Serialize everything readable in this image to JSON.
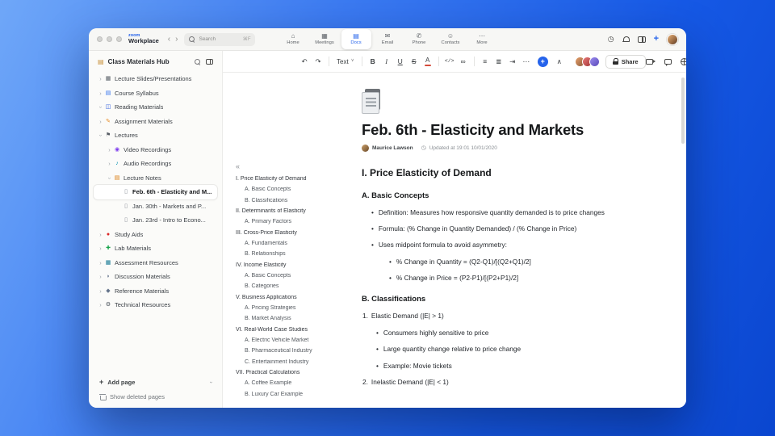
{
  "icons": {
    "back": "‹",
    "forward": "›",
    "tree_chevron": "›",
    "footer_chevron": "›",
    "plus": "+",
    "clock": "◷",
    "hub": "▤",
    "outline_collapse": "«",
    "more": "⋯"
  },
  "titlebar": {
    "brand_top": "zoom",
    "brand_bottom": "Workplace",
    "search": {
      "placeholder": "Search",
      "shortcut": "⌘F"
    },
    "tabs": [
      {
        "label": "Home",
        "icon": "home",
        "glyph": "⌂",
        "active": false
      },
      {
        "label": "Meetings",
        "icon": "meetings-calendar",
        "glyph": "▦",
        "active": false
      },
      {
        "label": "Docs",
        "icon": "docs-document",
        "glyph": "▤",
        "active": true
      },
      {
        "label": "Email",
        "icon": "email-envelope",
        "glyph": "✉",
        "active": false
      },
      {
        "label": "Phone",
        "icon": "phone",
        "glyph": "✆",
        "active": false
      },
      {
        "label": "Contacts",
        "icon": "contacts-person",
        "glyph": "☺",
        "active": false
      },
      {
        "label": "More",
        "icon": "more-dots",
        "glyph": "⋯",
        "active": false
      }
    ]
  },
  "sidebar": {
    "title": "Class Materials Hub",
    "items": [
      {
        "label": "Lecture Slides/Presentations",
        "depth": 0,
        "chevron": "right",
        "icon": "presentation",
        "glyph": "▦",
        "color": "#555b63"
      },
      {
        "label": "Course Syllabus",
        "depth": 0,
        "chevron": "right",
        "icon": "syllabus-document",
        "glyph": "▤",
        "color": "#2f6fed"
      },
      {
        "label": "Reading Materials",
        "depth": 0,
        "chevron": "down",
        "icon": "open-book",
        "glyph": "◫",
        "color": "#1d4ed8"
      },
      {
        "label": "Assignment Materials",
        "depth": 0,
        "chevron": "right",
        "icon": "assignment-pencil",
        "glyph": "✎",
        "color": "#e8912d"
      },
      {
        "label": "Lectures",
        "depth": 0,
        "chevron": "down",
        "icon": "lectures-flag",
        "glyph": "⚑",
        "color": "#555b63"
      },
      {
        "label": "Video Recordings",
        "depth": 1,
        "chevron": "right",
        "icon": "video-recording",
        "glyph": "◉",
        "color": "#7c3aed"
      },
      {
        "label": "Audio Recordings",
        "depth": 1,
        "chevron": "right",
        "icon": "audio-note",
        "glyph": "♪",
        "color": "#0891b2"
      },
      {
        "label": "Lecture Notes",
        "depth": 1,
        "chevron": "down",
        "icon": "notes-document",
        "glyph": "▤",
        "color": "#d97706"
      },
      {
        "label": "Feb. 6th - Elasticity and M...",
        "depth": 2,
        "chevron": null,
        "icon": "page",
        "glyph": "▯",
        "color": "#8a8f98",
        "selected": true
      },
      {
        "label": "Jan. 30th - Markets and P...",
        "depth": 2,
        "chevron": null,
        "icon": "page",
        "glyph": "▯",
        "color": "#8a8f98"
      },
      {
        "label": "Jan. 23rd - Intro to Econo...",
        "depth": 2,
        "chevron": null,
        "icon": "page",
        "glyph": "▯",
        "color": "#8a8f98"
      },
      {
        "label": "Study Aids",
        "depth": 0,
        "chevron": "right",
        "icon": "study-aid",
        "glyph": "●",
        "color": "#dc2626"
      },
      {
        "label": "Lab Materials",
        "depth": 0,
        "chevron": "right",
        "icon": "lab-cross",
        "glyph": "✚",
        "color": "#16a34a"
      },
      {
        "label": "Assessment Resources",
        "depth": 0,
        "chevron": "right",
        "icon": "assessment-grid",
        "glyph": "▦",
        "color": "#0e7490"
      },
      {
        "label": "Discussion Materials",
        "depth": 0,
        "chevron": "right",
        "icon": "discussion-bubble",
        "glyph": "◗",
        "color": "#64748b"
      },
      {
        "label": "Reference Materials",
        "depth": 0,
        "chevron": "right",
        "icon": "reference-diamond",
        "glyph": "◆",
        "color": "#64748b"
      },
      {
        "label": "Technical Resources",
        "depth": 0,
        "chevron": "right",
        "icon": "technical-gear",
        "glyph": "⚙",
        "color": "#475059"
      }
    ],
    "footer": {
      "add_page": "Add page",
      "show_deleted": "Show deleted pages"
    }
  },
  "toolbar": {
    "share_label": "Share",
    "controls": [
      {
        "type": "btn",
        "name": "undo",
        "glyph": "↶"
      },
      {
        "type": "btn",
        "name": "redo",
        "glyph": "↷"
      },
      {
        "type": "divider"
      },
      {
        "type": "text-dropdown",
        "name": "text-style-dropdown",
        "label": "Text"
      },
      {
        "type": "divider"
      },
      {
        "type": "btn",
        "name": "bold",
        "glyph": "B",
        "cls": "bold"
      },
      {
        "type": "btn",
        "name": "italic",
        "glyph": "I",
        "cls": "italic"
      },
      {
        "type": "btn",
        "name": "underline",
        "glyph": "U",
        "cls": "underline"
      },
      {
        "type": "btn",
        "name": "strikethrough",
        "glyph": "S",
        "cls": "strike"
      },
      {
        "type": "color",
        "name": "text-color",
        "glyph": "A"
      },
      {
        "type": "divider"
      },
      {
        "type": "btn",
        "name": "code",
        "glyph": "</>",
        "cls": "code"
      },
      {
        "type": "btn",
        "name": "link",
        "glyph": "∞"
      },
      {
        "type": "divider"
      },
      {
        "type": "btn",
        "name": "bullet-list",
        "glyph": "≡"
      },
      {
        "type": "btn",
        "name": "align",
        "glyph": "≣"
      },
      {
        "type": "btn",
        "name": "indent",
        "glyph": "⇥"
      },
      {
        "type": "btn",
        "name": "more-formatting",
        "glyph": "⋯"
      },
      {
        "type": "insert",
        "name": "insert",
        "glyph": "+"
      },
      {
        "type": "btn",
        "name": "collapse-toolbar",
        "glyph": "∧"
      }
    ]
  },
  "document": {
    "title": "Feb. 6th - Elasticity and Markets",
    "author": "Maurice Lawson",
    "updated": "Updated at 19:01 10/01/2020",
    "outline": [
      {
        "text": "I. Price Elasticity of Demand",
        "level": 1
      },
      {
        "text": "A. Basic Concepts",
        "level": 2
      },
      {
        "text": "B. Classifications",
        "level": 2
      },
      {
        "text": "II. Determinants of Elasticity",
        "level": 1
      },
      {
        "text": "A. Primary Factors",
        "level": 2
      },
      {
        "text": "III. Cross-Price Elasticity",
        "level": 1
      },
      {
        "text": "A. Fundamentals",
        "level": 2
      },
      {
        "text": "B. Relationships",
        "level": 2
      },
      {
        "text": "IV. Income Elasticity",
        "level": 1
      },
      {
        "text": "A. Basic Concepts",
        "level": 2
      },
      {
        "text": "B. Categories",
        "level": 2
      },
      {
        "text": "V. Business Applications",
        "level": 1
      },
      {
        "text": "A. Pricing Strategies",
        "level": 2
      },
      {
        "text": "B. Market Analysis",
        "level": 2
      },
      {
        "text": "VI. Real-World Case Studies",
        "level": 1
      },
      {
        "text": "A. Electric Vehicle Market",
        "level": 2
      },
      {
        "text": "B. Pharmaceutical Industry",
        "level": 2
      },
      {
        "text": "C. Entertainment Industry",
        "level": 2
      },
      {
        "text": "VII. Practical Calculations",
        "level": 1
      },
      {
        "text": "A. Coffee Example",
        "level": 2
      },
      {
        "text": "B. Luxury Car Example",
        "level": 2
      }
    ],
    "blocks": [
      {
        "type": "h2",
        "text": "I. Price Elasticity of Demand"
      },
      {
        "type": "h3",
        "text": "A. Basic Concepts"
      },
      {
        "type": "ul1",
        "text": "Definition: Measures how responsive quantity demanded is to price changes"
      },
      {
        "type": "ul1",
        "text": "Formula: (% Change in Quantity Demanded) / (% Change in Price)"
      },
      {
        "type": "ul1",
        "text": "Uses midpoint formula to avoid asymmetry:"
      },
      {
        "type": "ul2",
        "text": "% Change in Quantity = (Q2-Q1)/[(Q2+Q1)/2]"
      },
      {
        "type": "ul2",
        "text": "% Change in Price = (P2-P1)/[(P2+P1)/2]"
      },
      {
        "type": "h3",
        "text": "B. Classifications"
      },
      {
        "type": "ol1",
        "num": "1.",
        "text": "Elastic Demand (|E| > 1)"
      },
      {
        "type": "uln",
        "text": "Consumers highly sensitive to price"
      },
      {
        "type": "uln",
        "text": "Large quantity change relative to price change"
      },
      {
        "type": "uln",
        "text": "Example: Movie tickets"
      },
      {
        "type": "ol1",
        "num": "2.",
        "text": "Inelastic Demand (|E| < 1)"
      }
    ]
  }
}
